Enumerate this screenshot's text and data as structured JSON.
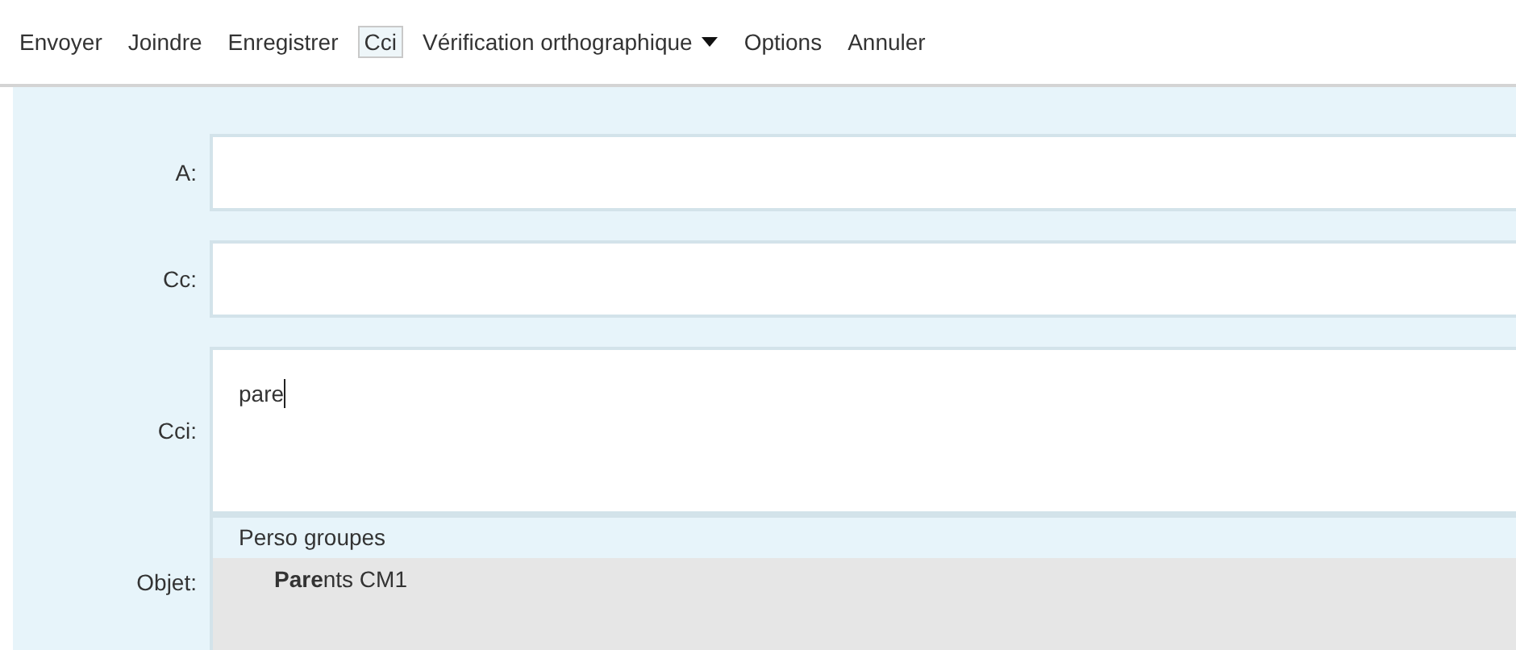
{
  "toolbar": [
    {
      "label": "Envoyer",
      "kind": "link",
      "selected": false
    },
    {
      "label": "Joindre",
      "kind": "link",
      "selected": false
    },
    {
      "label": "Enregistrer",
      "kind": "link",
      "selected": false
    },
    {
      "label": "Cci",
      "kind": "link",
      "selected": true
    },
    {
      "label": "Vérification orthographique",
      "kind": "dropdown",
      "selected": false
    },
    {
      "label": "Options",
      "kind": "link",
      "selected": false
    },
    {
      "label": "Annuler",
      "kind": "link",
      "selected": false
    }
  ],
  "fields": [
    {
      "label": "A:",
      "kind": "line"
    },
    {
      "label": "Cc:",
      "kind": "line"
    },
    {
      "label": "Cci:",
      "kind": "area",
      "value": "pare"
    }
  ],
  "subject": {
    "label": "Objet:"
  },
  "suggestions": {
    "group": "Perso groupes",
    "items": [
      {
        "text": "**Pare**nts CM1",
        "selected": true
      }
    ]
  }
}
